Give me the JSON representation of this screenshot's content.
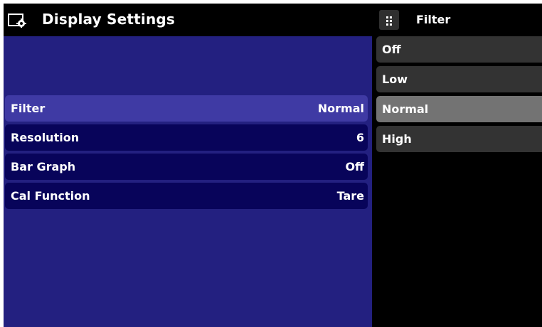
{
  "header": {
    "title": "Display Settings",
    "icon": "settings-display-icon"
  },
  "settings": {
    "rows": [
      {
        "label": "Filter",
        "value": "Normal",
        "selected": true
      },
      {
        "label": "Resolution",
        "value": "6",
        "selected": false
      },
      {
        "label": "Bar Graph",
        "value": "Off",
        "selected": false
      },
      {
        "label": "Cal Function",
        "value": "Tare",
        "selected": false
      }
    ]
  },
  "options_panel": {
    "title": "Filter",
    "icon": "grid-menu-icon",
    "options": [
      {
        "label": "Off",
        "selected": false
      },
      {
        "label": "Low",
        "selected": false
      },
      {
        "label": "Normal",
        "selected": true
      },
      {
        "label": "High",
        "selected": false
      }
    ]
  },
  "colors": {
    "panel_blue": "#232080",
    "row_navy": "#08045a",
    "row_selected": "#3f3aa4",
    "option_gray": "#333333",
    "option_selected": "#737373",
    "background": "#000000"
  }
}
